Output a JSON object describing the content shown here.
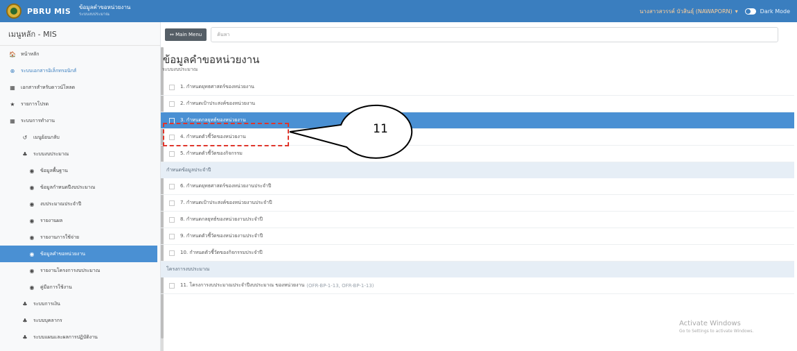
{
  "topbar": {
    "brand": "PBRU MIS",
    "subtitle_line1": "ข้อมูลคำขอหน่วยงาน",
    "subtitle_line2": "ระบบงบประมาณ",
    "user": "นางสาวสวรรค์ บัวสินธุ์ (NAWAPORN)",
    "dark_mode_label": "Dark Mode",
    "colors": {
      "bar": "#3a7ebf",
      "accent": "#4a90d3"
    }
  },
  "sidebar": {
    "title": "เมนูหลัก - MIS",
    "items": [
      {
        "icon": "home-icon",
        "glyph": "🏠",
        "label": "หน้าหลัก"
      },
      {
        "icon": "globe-icon",
        "glyph": "⊕",
        "label": "ระบบเอกสารอิเล็กทรอนิกส์"
      },
      {
        "icon": "book-icon",
        "glyph": "▦",
        "label": "เอกสารสำหรับดาวน์โหลด"
      },
      {
        "icon": "star-icon",
        "glyph": "★",
        "label": "รายการโปรด"
      },
      {
        "icon": "grid-icon",
        "glyph": "▦",
        "label": "ระบบการทำงาน"
      },
      {
        "icon": "undo-icon",
        "glyph": "↺",
        "label": "เมนูย้อนกลับ"
      },
      {
        "icon": "sitemap-icon",
        "glyph": "♣",
        "label": "ระบบงบประมาณ"
      },
      {
        "icon": "dot-icon",
        "glyph": "◉",
        "label": "ข้อมูลพื้นฐาน"
      },
      {
        "icon": "dot-icon",
        "glyph": "◉",
        "label": "ข้อมูลกำหนดปีงบประมาณ"
      },
      {
        "icon": "dot-icon",
        "glyph": "◉",
        "label": "งบประมาณประจำปี"
      },
      {
        "icon": "dot-icon",
        "glyph": "◉",
        "label": "รายงานผล"
      },
      {
        "icon": "dot-icon",
        "glyph": "◉",
        "label": "รายงานการใช้จ่าย"
      },
      {
        "icon": "dot-icon",
        "glyph": "◉",
        "label": "ข้อมูลคำขอหน่วยงาน"
      },
      {
        "icon": "dot-icon",
        "glyph": "◉",
        "label": "รายงานโครงการงบประมาณ"
      },
      {
        "icon": "dot-icon",
        "glyph": "◉",
        "label": "คู่มือการใช้งาน"
      },
      {
        "icon": "sitemap-icon",
        "glyph": "♣",
        "label": "ระบบการเงิน"
      },
      {
        "icon": "sitemap-icon",
        "glyph": "♣",
        "label": "ระบบบุคลากร"
      },
      {
        "icon": "sitemap-icon",
        "glyph": "♣",
        "label": "ระบบแผนและผลการปฏิบัติงาน"
      }
    ]
  },
  "toolbar": {
    "main_menu_label": "↔ Main Menu",
    "search_placeholder": "ค้นหา"
  },
  "main": {
    "title": "ข้อมูลคำขอหน่วยงาน",
    "subtitle": "ระบบงบประมาณ",
    "rows": [
      {
        "type": "row",
        "label": "1. กำหนดยุทธศาสตร์ของหน่วยงาน"
      },
      {
        "type": "row",
        "label": "2. กำหนดเป้าประสงค์ของหน่วยงาน"
      },
      {
        "type": "row",
        "label": "3. กำหนดกลยุทธ์ของหน่วยงาน",
        "selected": true
      },
      {
        "type": "row",
        "label": "4. กำหนดตัวชี้วัดของหน่วยงาน"
      },
      {
        "type": "row",
        "label": "5. กำหนดตัวชี้วัดของกิจกรรม"
      },
      {
        "type": "section",
        "label": "กำหนดข้อมูลประจำปี"
      },
      {
        "type": "row",
        "label": "6. กำหนดยุทธศาสตร์ของหน่วยงานประจำปี"
      },
      {
        "type": "row",
        "label": "7. กำหนดเป้าประสงค์ของหน่วยงานประจำปี"
      },
      {
        "type": "row",
        "label": "8. กำหนดกลยุทธ์ของหน่วยงานประจำปี"
      },
      {
        "type": "row",
        "label": "9. กำหนดตัวชี้วัดของหน่วยงานประจำปี"
      },
      {
        "type": "row",
        "label": "10. กำหนดตัวชี้วัดของกิจกรรมประจำปี"
      },
      {
        "type": "section",
        "label": "โครงการงบประมาณ"
      },
      {
        "type": "row",
        "label": "11. โครงการงบประมาณประจำปีงบประมาณ ของหน่วยงาน",
        "suffix": "(OFR-BP-1-13, OFR-BP-1-13)"
      }
    ]
  },
  "annotation": {
    "number": "11",
    "color": "#e0352b"
  },
  "watermark": {
    "line1": "Activate Windows",
    "line2": "Go to Settings to activate Windows."
  }
}
